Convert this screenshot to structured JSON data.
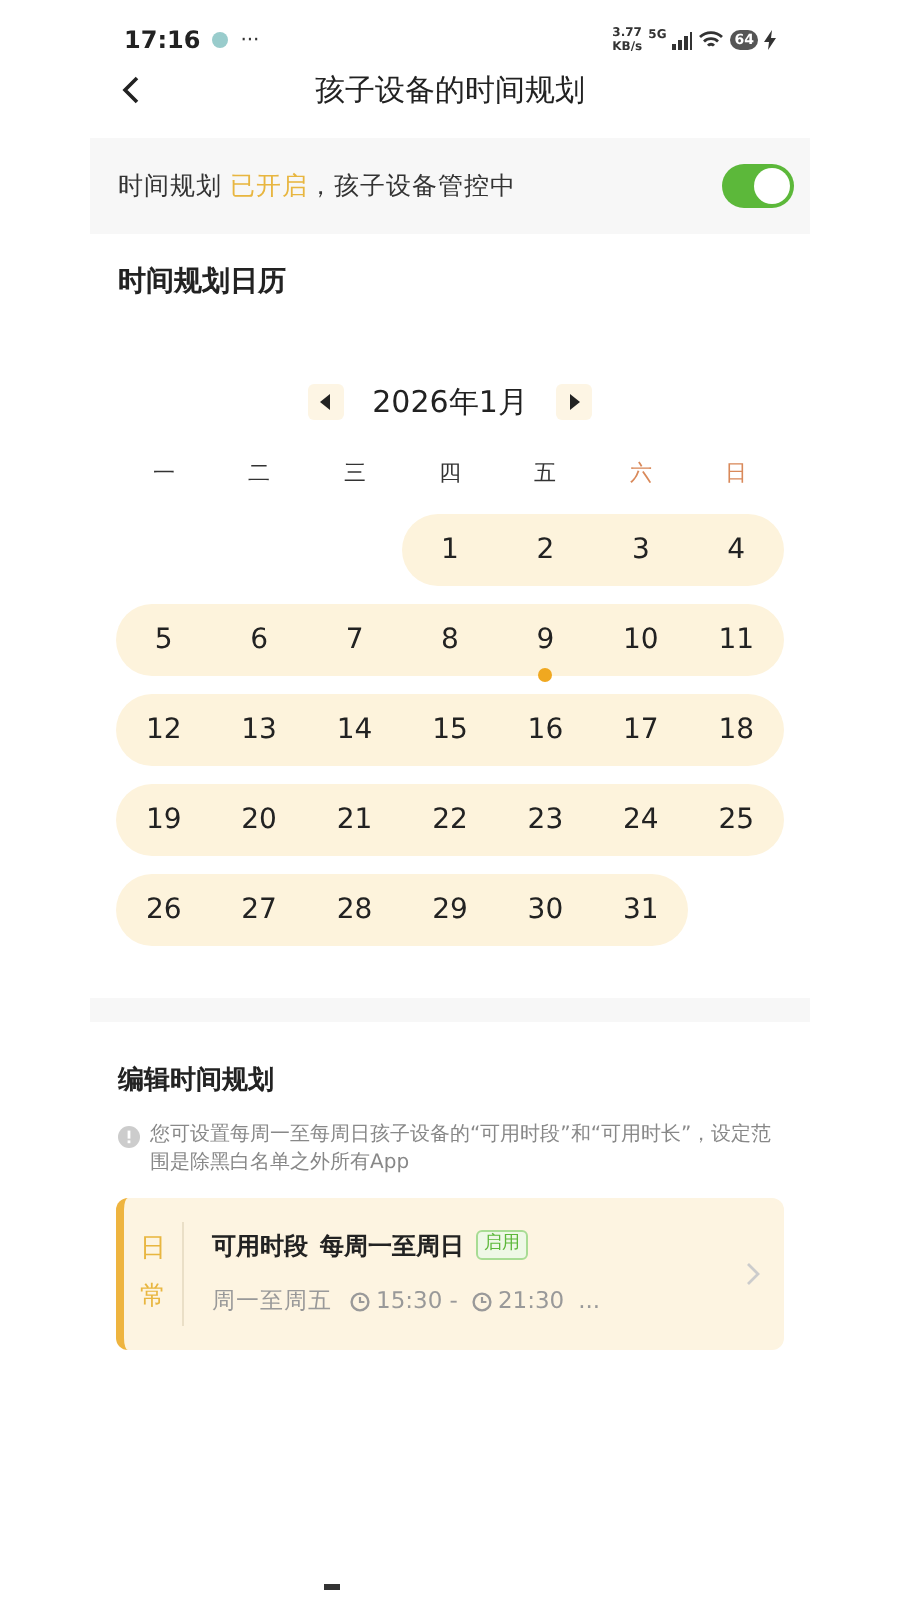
{
  "status_bar": {
    "time": "17:16",
    "dots": "···",
    "speed_value": "3.77",
    "speed_unit": "KB/s",
    "network": "5G",
    "battery": "64"
  },
  "header": {
    "title": "孩子设备的时间规划"
  },
  "plan_status": {
    "prefix": "时间规划",
    "state_text": "已开启",
    "suffix": "，孩子设备管控中",
    "on": true
  },
  "calendar": {
    "title": "时间规划日历",
    "month": "2026年1月",
    "weekdays": [
      {
        "label": "一",
        "weekend": false
      },
      {
        "label": "二",
        "weekend": false
      },
      {
        "label": "三",
        "weekend": false
      },
      {
        "label": "四",
        "weekend": false
      },
      {
        "label": "五",
        "weekend": false
      },
      {
        "label": "六",
        "weekend": true
      },
      {
        "label": "日",
        "weekend": true
      }
    ],
    "days": [
      {
        "label": "1",
        "marked": false
      },
      {
        "label": "2",
        "marked": false
      },
      {
        "label": "3",
        "marked": false
      },
      {
        "label": "4",
        "marked": false
      },
      {
        "label": "5",
        "marked": false
      },
      {
        "label": "6",
        "marked": false
      },
      {
        "label": "7",
        "marked": false
      },
      {
        "label": "8",
        "marked": false
      },
      {
        "label": "9",
        "marked": true
      },
      {
        "label": "10",
        "marked": false
      },
      {
        "label": "11",
        "marked": false
      },
      {
        "label": "12",
        "marked": false
      },
      {
        "label": "13",
        "marked": false
      },
      {
        "label": "14",
        "marked": false
      },
      {
        "label": "15",
        "marked": false
      },
      {
        "label": "16",
        "marked": false
      },
      {
        "label": "17",
        "marked": false
      },
      {
        "label": "18",
        "marked": false
      },
      {
        "label": "19",
        "marked": false
      },
      {
        "label": "20",
        "marked": false
      },
      {
        "label": "21",
        "marked": false
      },
      {
        "label": "22",
        "marked": false
      },
      {
        "label": "23",
        "marked": false
      },
      {
        "label": "24",
        "marked": false
      },
      {
        "label": "25",
        "marked": false
      },
      {
        "label": "26",
        "marked": false
      },
      {
        "label": "27",
        "marked": false
      },
      {
        "label": "28",
        "marked": false
      },
      {
        "label": "29",
        "marked": false
      },
      {
        "label": "30",
        "marked": false
      },
      {
        "label": "31",
        "marked": false
      }
    ]
  },
  "edit": {
    "title": "编辑时间规划",
    "info": "您可设置每周一至每周日孩子设备的“可用时段”和“可用时长”，设定范围是除黑白名单之外所有App",
    "plans": [
      {
        "side_label": [
          "日",
          "常"
        ],
        "title": "可用时段",
        "range": "每周一至周日",
        "badge": "启用",
        "days": "周一至周五",
        "start": "15:30 -",
        "end": "21:30",
        "more": "..."
      }
    ]
  }
}
